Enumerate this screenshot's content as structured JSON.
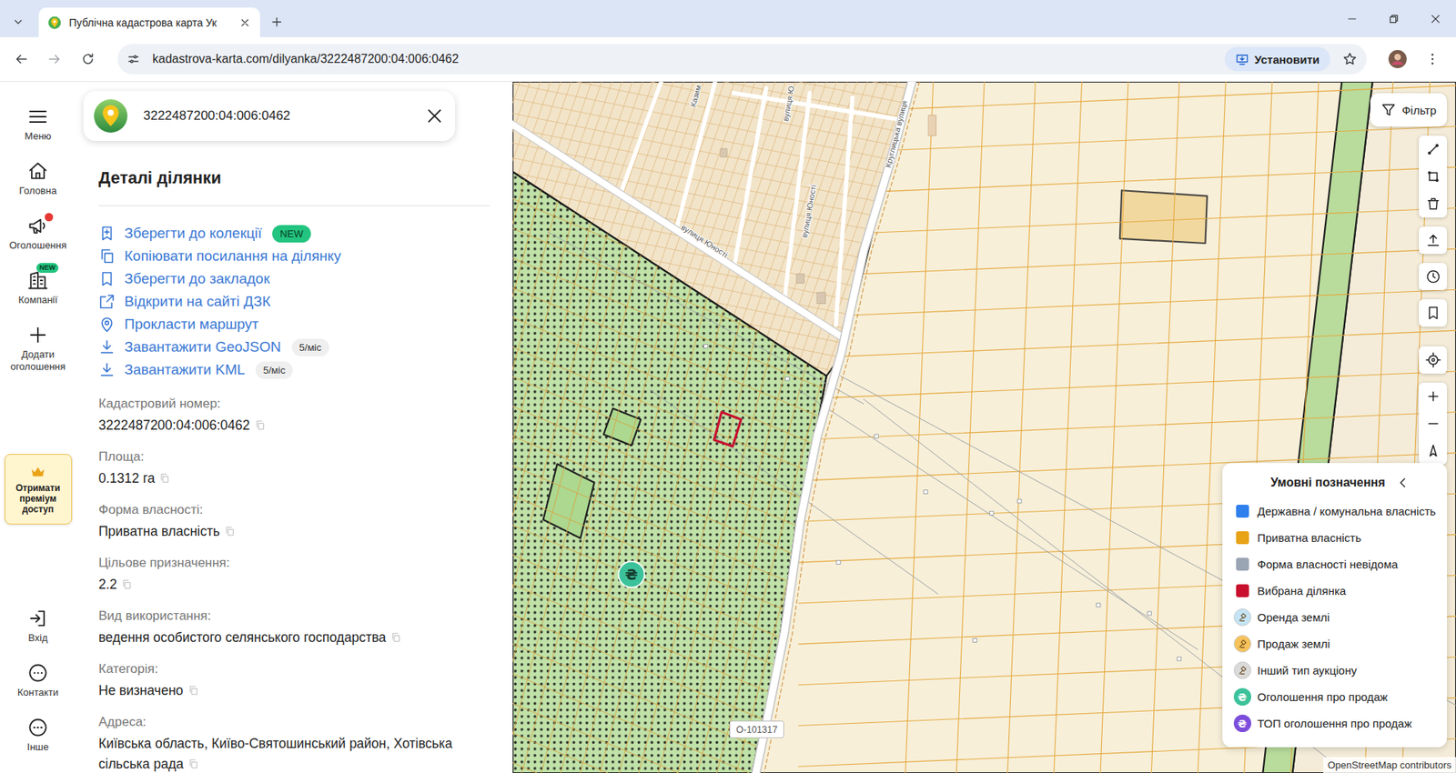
{
  "browser": {
    "tab_title": "Публічна кадастрова карта Ук",
    "url": "kadastrova-karta.com/dilyanka/3222487200:04:006:0462",
    "install_label": "Установити"
  },
  "nav_rail": {
    "items": [
      {
        "label": "Меню",
        "notification": false
      },
      {
        "label": "Головна",
        "notification": false
      },
      {
        "label": "Оголошення",
        "notification": true
      },
      {
        "label": "Компанії",
        "notification": false,
        "badge": "NEW",
        "badge_kind": "new"
      },
      {
        "label": "Додати оголошення",
        "notification": false
      }
    ],
    "premium": "Отримати преміум доступ",
    "bottom_items": [
      {
        "label": "Вхід"
      },
      {
        "label": "Контакти"
      },
      {
        "label": "Інше"
      }
    ]
  },
  "panel": {
    "search_value": "3222487200:04:006:0462",
    "heading": "Деталі ділянки",
    "actions": [
      {
        "label": "Зберегти до колекції",
        "badge": "NEW",
        "badge_kind": "new"
      },
      {
        "label": "Копіювати посилання на ділянку"
      },
      {
        "label": "Зберегти до закладок"
      },
      {
        "label": "Відкрити на сайті ДЗК"
      },
      {
        "label": "Прокласти маршрут"
      },
      {
        "label": "Завантажити GeoJSON",
        "badge": "5/міс",
        "badge_kind": "quota"
      },
      {
        "label": "Завантажити KML",
        "badge": "5/міс",
        "badge_kind": "quota"
      }
    ],
    "fields": [
      {
        "label": "Кадастровий номер:",
        "value": "3222487200:04:006:0462",
        "copyable": true
      },
      {
        "label": "Площа:",
        "value": "0.1312 га",
        "copyable": true
      },
      {
        "label": "Форма власності:",
        "value": "Приватна власність",
        "copyable": true
      },
      {
        "label": "Цільове призначення:",
        "value": "2.2",
        "copyable": true
      },
      {
        "label": "Вид використання:",
        "value": "ведення особистого селянського господарства",
        "copyable": true
      },
      {
        "label": "Категорія:",
        "value": "Не визначено",
        "copyable": true
      },
      {
        "label": "Адреса:",
        "value": "Київська область, Київо-Святошинський район, Хотівська сільська рада",
        "copyable": true
      }
    ]
  },
  "map": {
    "filter_label": "Фільтр",
    "streets": [
      "Круглицька вулиця",
      "вулиця Юності",
      "вулиця Юності",
      "вулиця Ю",
      "Казим"
    ],
    "road_ref": "O-101317",
    "marker_glyph": "₴",
    "attribution": "OpenStreetMap contributors",
    "legend": {
      "title": "Умовні позначення",
      "items": [
        {
          "label": "Державна / комунальна власність",
          "kind": "swatch",
          "color": "#2f80ed"
        },
        {
          "label": "Приватна власність",
          "kind": "swatch",
          "color": "#e8a317"
        },
        {
          "label": "Форма власності невідома",
          "kind": "swatch",
          "color": "#9aa5b4"
        },
        {
          "label": "Вибрана ділянка",
          "kind": "swatch",
          "color": "#c8102e"
        },
        {
          "label": "Оренда землі",
          "kind": "auction",
          "color": "#c4e4f5"
        },
        {
          "label": "Продаж землі",
          "kind": "auction",
          "color": "#f6c25a"
        },
        {
          "label": "Інший тип аукціону",
          "kind": "auction",
          "color": "#dadada"
        },
        {
          "label": "Оголошення про продаж",
          "kind": "listing",
          "color": "#3cc29a",
          "glyph": "₴"
        },
        {
          "label": "ТОП оголошення про продаж",
          "kind": "listing",
          "color": "#7c4ddb",
          "glyph": "₴"
        }
      ]
    }
  }
}
